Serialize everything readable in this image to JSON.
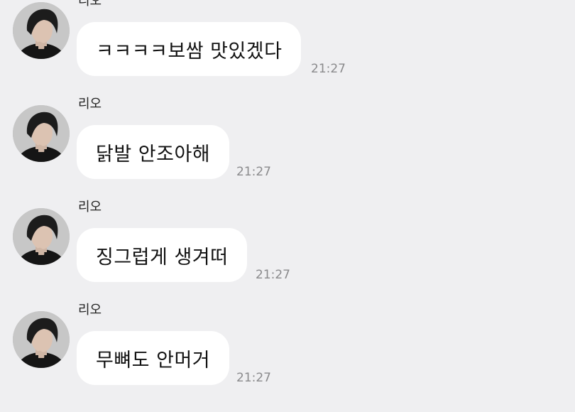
{
  "chat": {
    "messages": [
      {
        "sender": "리오",
        "text": "ㅋㅋㅋㅋ보쌈 맛있겠다",
        "time": "21:27"
      },
      {
        "sender": "리오",
        "text": "닭발 안조아해",
        "time": "21:27"
      },
      {
        "sender": "리오",
        "text": "징그럽게 생겨떠",
        "time": "21:27"
      },
      {
        "sender": "리오",
        "text": "무뼈도 안머거",
        "time": "21:27"
      }
    ]
  },
  "colors": {
    "background": "#efeff1",
    "bubble": "#ffffff",
    "time_text": "#8a8a8c"
  },
  "icons": {
    "avatar": "profile-photo-avatar"
  }
}
